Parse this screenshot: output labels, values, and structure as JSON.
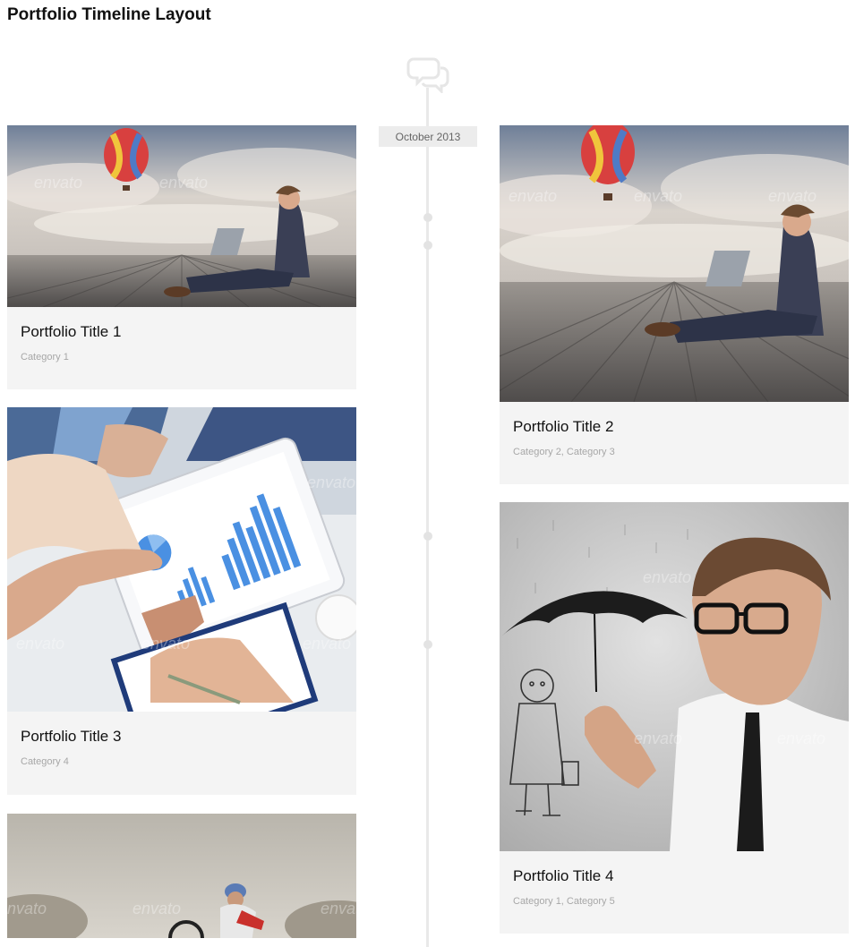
{
  "page": {
    "title": "Portfolio Timeline Layout"
  },
  "timeline": {
    "month": "October 2013",
    "icon": "comments-icon"
  },
  "items": [
    {
      "title": "Portfolio Title 1",
      "categories": "Category 1",
      "image": "balloon-laptop-man-photo"
    },
    {
      "title": "Portfolio Title 2",
      "categories": "Category 2, Category 3",
      "image": "balloon-laptop-man-photo"
    },
    {
      "title": "Portfolio Title 3",
      "categories": "Category 4",
      "image": "tablet-business-chart-photo"
    },
    {
      "title": "Portfolio Title 4",
      "categories": "Category 1, Category 5",
      "image": "umbrella-businessman-photo"
    },
    {
      "title": "",
      "categories": "",
      "image": "cyclist-photo"
    }
  ],
  "watermark": "envato"
}
